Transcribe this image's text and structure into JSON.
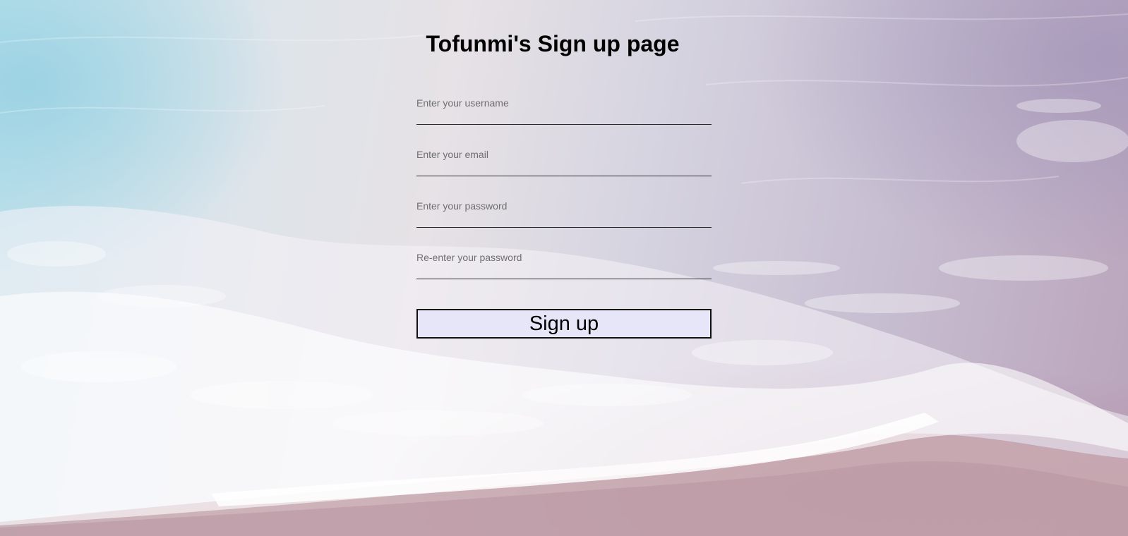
{
  "page": {
    "title": "Tofunmi's Sign up page"
  },
  "form": {
    "username": {
      "placeholder": "Enter your username",
      "value": ""
    },
    "email": {
      "placeholder": "Enter your email",
      "value": ""
    },
    "password": {
      "placeholder": "Enter your password",
      "value": ""
    },
    "confirm_password": {
      "placeholder": "Re-enter your password",
      "value": ""
    },
    "submit_label": "Sign up"
  },
  "colors": {
    "button_background": "#e6e6f8",
    "input_underline": "#2b2b2b"
  }
}
